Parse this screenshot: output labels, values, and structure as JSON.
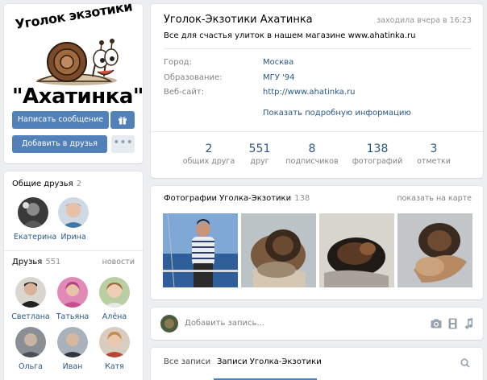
{
  "profile": {
    "logo_top_text": "Уголок экзотики",
    "logo_bottom_text": "\"Ахатинка\"",
    "name": "Уголок-Экзотики Ахатинка",
    "last_seen": "заходила вчера в 16:23",
    "status": "Все для счастья улиток в нашем магазине www.ahatinka.ru",
    "info": [
      {
        "label": "Город:",
        "value": "Москва"
      },
      {
        "label": "Образование:",
        "value": "МГУ '94"
      },
      {
        "label": "Веб-сайт:",
        "value": "http://www.ahatinka.ru"
      }
    ],
    "more_info": "Показать подробную информацию"
  },
  "actions": {
    "message_button": "Написать сообщение",
    "add_friend_button": "Добавить в друзья",
    "gift_icon": "gift-icon",
    "more_icon": "more-dots-icon"
  },
  "counters": [
    {
      "value": "2",
      "label": "общих друга"
    },
    {
      "value": "551",
      "label": "друг"
    },
    {
      "value": "8",
      "label": "подписчиков"
    },
    {
      "value": "138",
      "label": "фотографий"
    },
    {
      "value": "3",
      "label": "отметки"
    }
  ],
  "mutual_friends": {
    "title": "Общие друзья",
    "count": "2",
    "items": [
      {
        "name": "Екатерина"
      },
      {
        "name": "Ирина"
      }
    ]
  },
  "friends": {
    "title": "Друзья",
    "count": "551",
    "news_link": "новости",
    "items": [
      {
        "name": "Светлана"
      },
      {
        "name": "Татьяна"
      },
      {
        "name": "Алёна"
      },
      {
        "name": "Ольга"
      },
      {
        "name": "Иван"
      },
      {
        "name": "Катя"
      }
    ]
  },
  "photos": {
    "title": "Фотографии Уголка-Экзотики",
    "count": "138",
    "map_link": "показать на карте"
  },
  "composer": {
    "placeholder": "Добавить запись...",
    "icons": [
      "camera-icon",
      "video-icon",
      "music-icon"
    ]
  },
  "wall": {
    "tabs": [
      "Все записи",
      "Записи Уголка-Экзотики"
    ],
    "active_tab": 1,
    "search_icon": "search-icon"
  },
  "colors": {
    "background": "#edeef0",
    "link": "#2a5885",
    "button_primary": "#5181b8",
    "muted": "#828282"
  }
}
